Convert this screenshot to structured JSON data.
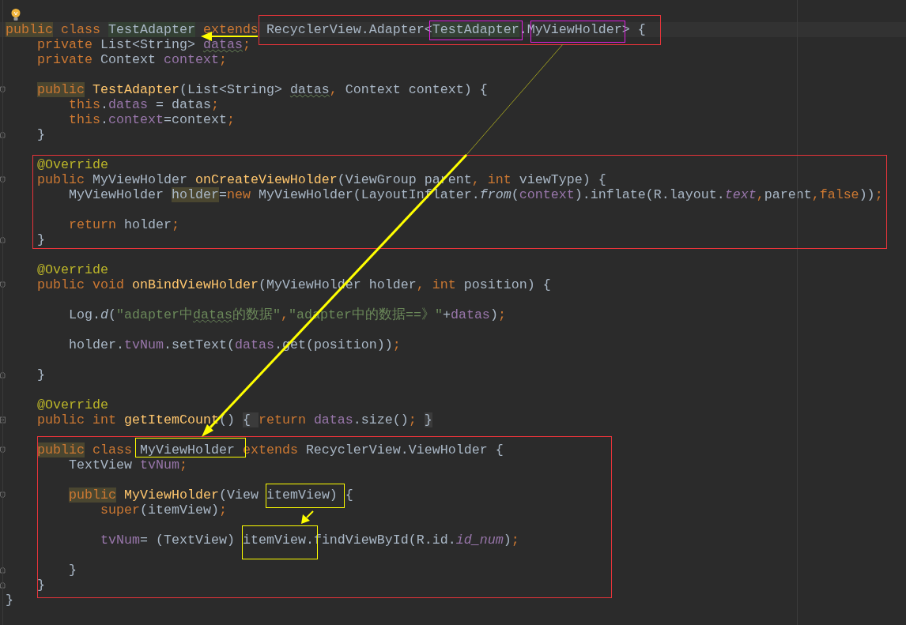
{
  "editor": {
    "lines": [
      {
        "bulb": true,
        "kind": "blank"
      },
      {
        "current": true,
        "kind": "code",
        "tokens": [
          {
            "text": "public",
            "kind": "kw",
            "highlight": {
              "kind": "usage"
            }
          },
          {
            "text": " class ",
            "kind": "kw"
          },
          {
            "text": "TestAdapter",
            "kind": "plain",
            "highlight": {
              "kind": "declaration"
            }
          },
          {
            "text": " extends ",
            "kind": "kw"
          },
          {
            "text": "RecyclerView.Adapter<",
            "kind": "plain"
          },
          {
            "text": "TestAdapter",
            "kind": "plain",
            "highlight": {
              "kind": "declaration"
            }
          },
          {
            "text": ".MyViewHolder> {",
            "kind": "plain"
          }
        ],
        "children": [
          {
            "kind": "code",
            "tokens": [
              {
                "text": "private ",
                "kind": "kw"
              },
              {
                "text": "List<String> ",
                "kind": "plain"
              },
              {
                "text": "datas",
                "kind": "field",
                "wavy": true
              },
              {
                "text": ";",
                "kind": "kw"
              }
            ]
          },
          {
            "kind": "code",
            "tokens": [
              {
                "text": "private ",
                "kind": "kw"
              },
              {
                "text": "Context ",
                "kind": "plain"
              },
              {
                "text": "context",
                "kind": "field"
              },
              {
                "text": ";",
                "kind": "kw"
              }
            ]
          },
          {
            "kind": "blank"
          },
          {
            "kind": "code",
            "fold": {
              "kind": "start"
            },
            "tokens": [
              {
                "text": "public",
                "kind": "kw",
                "highlight": {
                  "kind": "usage"
                }
              },
              {
                "text": " TestAdapter",
                "kind": "fn"
              },
              {
                "text": "(List<String> ",
                "kind": "plain"
              },
              {
                "text": "datas",
                "kind": "plain",
                "wavy": true
              },
              {
                "text": ", ",
                "kind": "kw"
              },
              {
                "text": "Context context) {",
                "kind": "plain"
              }
            ],
            "children": [
              {
                "kind": "code",
                "tokens": [
                  {
                    "text": "this",
                    "kind": "kw"
                  },
                  {
                    "text": ".",
                    "kind": "plain"
                  },
                  {
                    "text": "datas",
                    "kind": "field"
                  },
                  {
                    "text": " = datas",
                    "kind": "plain"
                  },
                  {
                    "text": ";",
                    "kind": "kw"
                  }
                ]
              },
              {
                "kind": "code",
                "tokens": [
                  {
                    "text": "this",
                    "kind": "kw"
                  },
                  {
                    "text": ".",
                    "kind": "plain"
                  },
                  {
                    "text": "context",
                    "kind": "field"
                  },
                  {
                    "text": "=context",
                    "kind": "plain"
                  },
                  {
                    "text": ";",
                    "kind": "kw"
                  }
                ]
              }
            ]
          },
          {
            "kind": "code",
            "fold": {
              "kind": "end"
            },
            "tokens": [
              {
                "text": "}",
                "kind": "plain"
              }
            ]
          },
          {
            "kind": "blank"
          },
          {
            "kind": "code",
            "tokens": [
              {
                "text": "@Override",
                "kind": "ann"
              }
            ]
          },
          {
            "kind": "code",
            "fold": {
              "kind": "start"
            },
            "tokens": [
              {
                "text": "public ",
                "kind": "kw"
              },
              {
                "text": "MyViewHolder ",
                "kind": "plain"
              },
              {
                "text": "onCreateViewHolder",
                "kind": "fn"
              },
              {
                "text": "(ViewGroup parent",
                "kind": "plain"
              },
              {
                "text": ", ",
                "kind": "kw"
              },
              {
                "text": "int ",
                "kind": "kw"
              },
              {
                "text": "viewType) {",
                "kind": "plain"
              }
            ],
            "children": [
              {
                "kind": "code",
                "tokens": [
                  {
                    "text": "MyViewHolder ",
                    "kind": "plain"
                  },
                  {
                    "text": "holder",
                    "kind": "plain",
                    "highlight": {
                      "kind": "usage"
                    }
                  },
                  {
                    "text": "=",
                    "kind": "plain"
                  },
                  {
                    "text": "new ",
                    "kind": "kw"
                  },
                  {
                    "text": "MyViewHolder(LayoutInflater.",
                    "kind": "plain"
                  },
                  {
                    "text": "from",
                    "kind": "static"
                  },
                  {
                    "text": "(",
                    "kind": "plain"
                  },
                  {
                    "text": "context",
                    "kind": "field"
                  },
                  {
                    "text": ").inflate(R.layout.",
                    "kind": "plain"
                  },
                  {
                    "text": "text",
                    "kind": "staticfield"
                  },
                  {
                    "text": ",",
                    "kind": "kw"
                  },
                  {
                    "text": "parent",
                    "kind": "plain"
                  },
                  {
                    "text": ",",
                    "kind": "kw"
                  },
                  {
                    "text": "false",
                    "kind": "kw"
                  },
                  {
                    "text": "))",
                    "kind": "plain"
                  },
                  {
                    "text": ";",
                    "kind": "kw"
                  }
                ]
              },
              {
                "kind": "blank"
              },
              {
                "kind": "code",
                "tokens": [
                  {
                    "text": "return ",
                    "kind": "kw"
                  },
                  {
                    "text": "holder",
                    "kind": "plain"
                  },
                  {
                    "text": ";",
                    "kind": "kw"
                  }
                ]
              }
            ]
          },
          {
            "kind": "code",
            "fold": {
              "kind": "end"
            },
            "tokens": [
              {
                "text": "}",
                "kind": "plain"
              }
            ]
          },
          {
            "kind": "blank"
          },
          {
            "kind": "code",
            "tokens": [
              {
                "text": "@Override",
                "kind": "ann"
              }
            ]
          },
          {
            "kind": "code",
            "fold": {
              "kind": "start"
            },
            "tokens": [
              {
                "text": "public void ",
                "kind": "kw"
              },
              {
                "text": "onBindViewHolder",
                "kind": "fn"
              },
              {
                "text": "(MyViewHolder holder",
                "kind": "plain"
              },
              {
                "text": ", ",
                "kind": "kw"
              },
              {
                "text": "int ",
                "kind": "kw"
              },
              {
                "text": "position) {",
                "kind": "plain"
              }
            ],
            "children": [
              {
                "kind": "blank"
              },
              {
                "kind": "code",
                "tokens": [
                  {
                    "text": "Log.",
                    "kind": "plain"
                  },
                  {
                    "text": "d",
                    "kind": "static"
                  },
                  {
                    "text": "(",
                    "kind": "plain"
                  },
                  {
                    "text": "\"adapter中",
                    "kind": "str"
                  },
                  {
                    "text": "datas",
                    "kind": "str",
                    "wavy": true
                  },
                  {
                    "text": "的数据\"",
                    "kind": "str"
                  },
                  {
                    "text": ",",
                    "kind": "kw"
                  },
                  {
                    "text": "\"adapter中的数据==》\"",
                    "kind": "str"
                  },
                  {
                    "text": "+",
                    "kind": "plain"
                  },
                  {
                    "text": "datas",
                    "kind": "field"
                  },
                  {
                    "text": ")",
                    "kind": "plain"
                  },
                  {
                    "text": ";",
                    "kind": "kw"
                  }
                ]
              },
              {
                "kind": "blank"
              },
              {
                "kind": "code",
                "tokens": [
                  {
                    "text": "holder.",
                    "kind": "plain"
                  },
                  {
                    "text": "tvNum",
                    "kind": "field"
                  },
                  {
                    "text": ".setText(",
                    "kind": "plain"
                  },
                  {
                    "text": "datas",
                    "kind": "field"
                  },
                  {
                    "text": ".get(position))",
                    "kind": "plain"
                  },
                  {
                    "text": ";",
                    "kind": "kw"
                  }
                ]
              },
              {
                "kind": "blank"
              }
            ]
          },
          {
            "kind": "code",
            "fold": {
              "kind": "end"
            },
            "tokens": [
              {
                "text": "}",
                "kind": "plain"
              }
            ]
          },
          {
            "kind": "blank"
          },
          {
            "kind": "code",
            "tokens": [
              {
                "text": "@Override",
                "kind": "ann"
              }
            ]
          },
          {
            "kind": "code",
            "fold": {
              "kind": "collapsed"
            },
            "tokens": [
              {
                "text": "public int ",
                "kind": "kw"
              },
              {
                "text": "getItemCount",
                "kind": "fn"
              },
              {
                "text": "() ",
                "kind": "plain"
              },
              {
                "text": "{ ",
                "kind": "plain",
                "highlight": {
                  "kind": "fold"
                }
              },
              {
                "text": "return ",
                "kind": "kw"
              },
              {
                "text": "datas",
                "kind": "field"
              },
              {
                "text": ".size()",
                "kind": "plain"
              },
              {
                "text": "; ",
                "kind": "kw"
              },
              {
                "text": "}",
                "kind": "plain",
                "highlight": {
                  "kind": "fold"
                }
              }
            ]
          },
          {
            "kind": "blank"
          },
          {
            "kind": "code",
            "fold": {
              "kind": "start"
            },
            "tokens": [
              {
                "text": "public",
                "kind": "kw",
                "highlight": {
                  "kind": "usage"
                }
              },
              {
                "text": " class ",
                "kind": "kw"
              },
              {
                "text": "MyViewHolder ",
                "kind": "plain"
              },
              {
                "text": "extends ",
                "kind": "kw"
              },
              {
                "text": "RecyclerView.ViewHolder {",
                "kind": "plain"
              }
            ],
            "children": [
              {
                "kind": "code",
                "tokens": [
                  {
                    "text": "TextView ",
                    "kind": "plain"
                  },
                  {
                    "text": "tvNum",
                    "kind": "field"
                  },
                  {
                    "text": ";",
                    "kind": "kw"
                  }
                ]
              },
              {
                "kind": "blank"
              },
              {
                "kind": "code",
                "fold": {
                  "kind": "start"
                },
                "tokens": [
                  {
                    "text": "public",
                    "kind": "kw",
                    "highlight": {
                      "kind": "usage"
                    }
                  },
                  {
                    "text": " MyViewHolder",
                    "kind": "fn"
                  },
                  {
                    "text": "(View itemView) {",
                    "kind": "plain"
                  }
                ],
                "children": [
                  {
                    "kind": "code",
                    "tokens": [
                      {
                        "text": "super",
                        "kind": "kw"
                      },
                      {
                        "text": "(itemView)",
                        "kind": "plain"
                      },
                      {
                        "text": ";",
                        "kind": "kw"
                      }
                    ]
                  },
                  {
                    "kind": "blank"
                  },
                  {
                    "kind": "code",
                    "tokens": [
                      {
                        "text": "tvNum",
                        "kind": "field"
                      },
                      {
                        "text": "= (TextView) itemView.findViewById(R.id.",
                        "kind": "plain"
                      },
                      {
                        "text": "id_num",
                        "kind": "staticfield"
                      },
                      {
                        "text": ")",
                        "kind": "plain"
                      },
                      {
                        "text": ";",
                        "kind": "kw"
                      }
                    ]
                  },
                  {
                    "kind": "blank"
                  }
                ]
              },
              {
                "kind": "code",
                "fold": {
                  "kind": "end"
                },
                "tokens": [
                  {
                    "text": "}",
                    "kind": "plain"
                  }
                ]
              }
            ]
          },
          {
            "kind": "code",
            "fold": {
              "kind": "end"
            },
            "tokens": [
              {
                "text": "}",
                "kind": "plain"
              }
            ]
          }
        ]
      },
      {
        "kind": "code",
        "tokens": [
          {
            "text": "}",
            "kind": "plain"
          }
        ]
      }
    ]
  }
}
